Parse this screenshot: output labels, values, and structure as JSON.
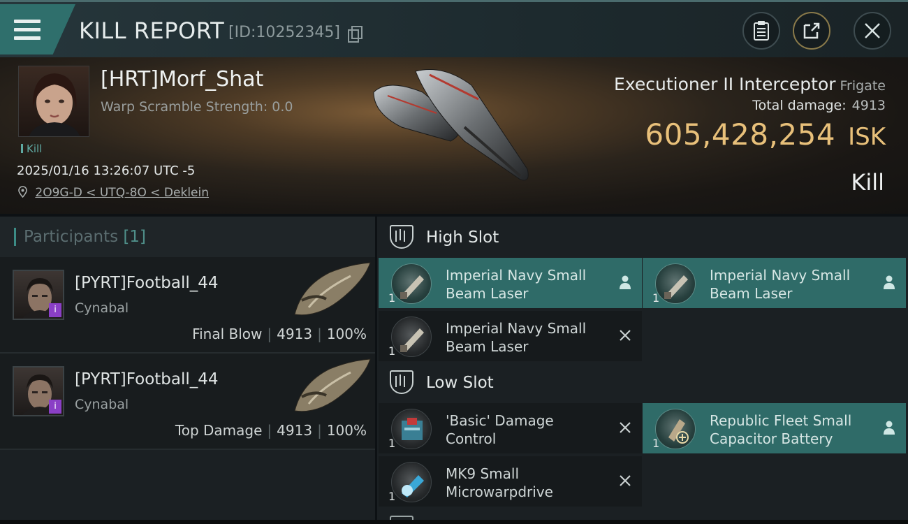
{
  "header": {
    "title": "KILL REPORT",
    "report_id": "[ID:10252345]"
  },
  "victim": {
    "name": "[HRT]Morf_Shat",
    "warp_scramble": "Warp Scramble Strength: 0.0",
    "tag": "Kill",
    "datetime": "2025/01/16 13:26:07 UTC -5",
    "location": "2O9G-D < UTQ-8O < Deklein"
  },
  "ship": {
    "name": "Executioner II Interceptor",
    "class": "Frigate",
    "total_damage_label": "Total damage:",
    "total_damage": "4913",
    "isk_value": "605,428,254",
    "isk_unit": "ISK",
    "result": "Kill"
  },
  "participants": {
    "title": "Participants",
    "count": "[1]",
    "items": [
      {
        "name": "[PYRT]Football_44",
        "ship": "Cynabal",
        "role": "Final Blow",
        "damage": "4913",
        "percent": "100%",
        "badge": "i"
      },
      {
        "name": "[PYRT]Football_44",
        "ship": "Cynabal",
        "role": "Top Damage",
        "damage": "4913",
        "percent": "100%",
        "badge": "i"
      }
    ]
  },
  "fittings": {
    "high_slot": {
      "title": "High Slot",
      "modules": [
        {
          "name": "Imperial Navy Small Beam Laser",
          "qty": "1",
          "status": "dropped"
        },
        {
          "name": "Imperial Navy Small Beam Laser",
          "qty": "1",
          "status": "dropped"
        },
        {
          "name": "Imperial Navy Small Beam Laser",
          "qty": "1",
          "status": "destroyed"
        }
      ]
    },
    "low_slot": {
      "title": "Low Slot",
      "modules": [
        {
          "name": "'Basic' Damage Control",
          "qty": "1",
          "status": "destroyed"
        },
        {
          "name": "Republic Fleet Small Capacitor Battery",
          "qty": "1",
          "status": "dropped"
        },
        {
          "name": "MK9 Small Microwarpdrive",
          "qty": "1",
          "status": "destroyed"
        }
      ]
    }
  },
  "icons": {
    "menu": "hamburger-icon",
    "copy": "copy-icon",
    "report": "clipboard-icon",
    "share": "share-icon",
    "close": "close-icon",
    "location": "pin-icon",
    "slot": "slot-shield-icon",
    "dropped": "person-icon",
    "destroyed": "x-icon"
  },
  "colors": {
    "accent_teal": "#2f6b68",
    "isk_gold": "#e8c07a",
    "badge_purple": "#8a3fc6"
  }
}
